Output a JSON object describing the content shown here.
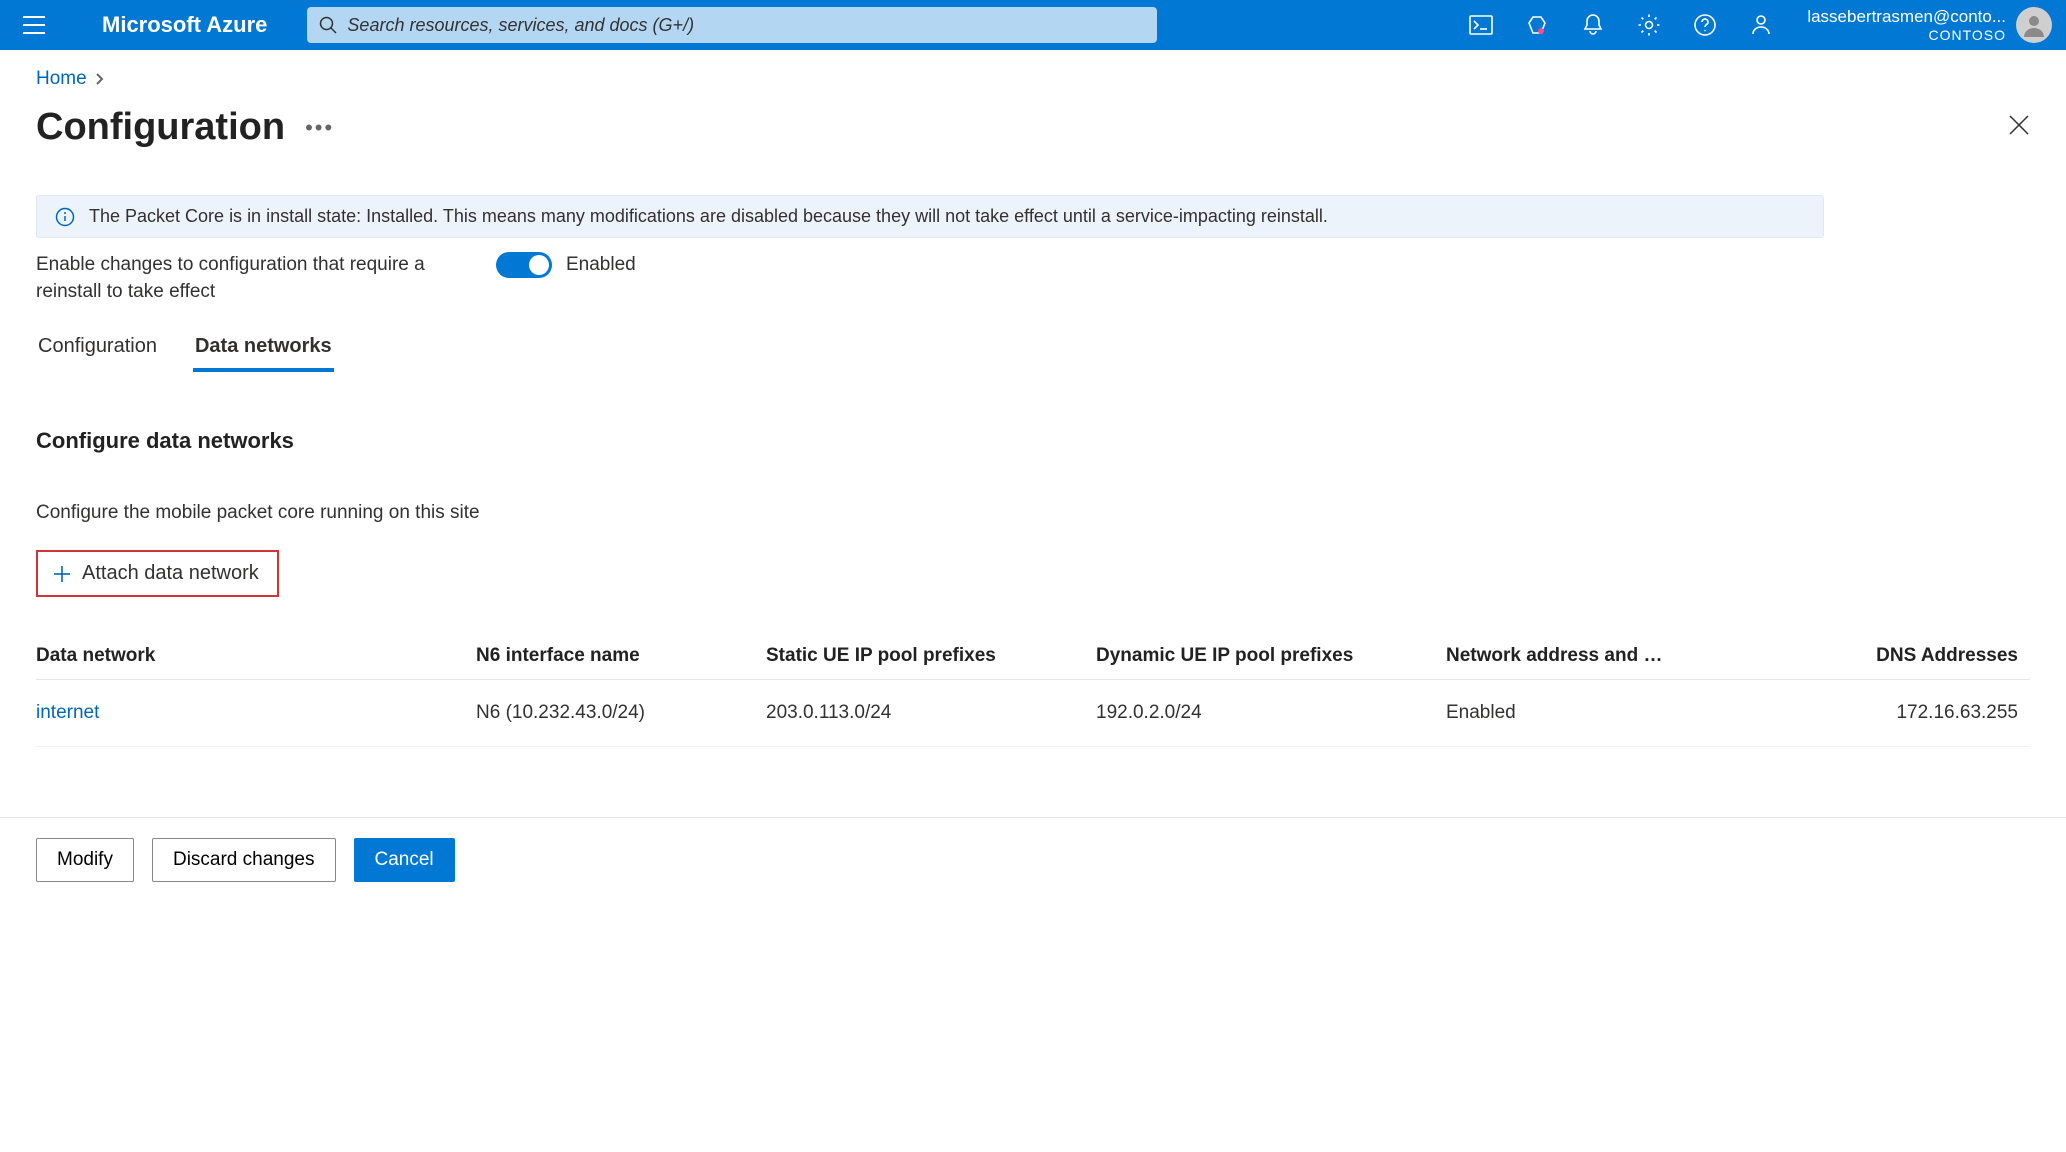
{
  "header": {
    "brand": "Microsoft Azure",
    "search_placeholder": "Search resources, services, and docs (G+/)",
    "account_email": "lassebertrasmen@conto...",
    "tenant": "CONTOSO"
  },
  "breadcrumb": {
    "home": "Home"
  },
  "page": {
    "title": "Configuration",
    "info_text": "The Packet Core is in install state: Installed. This means many modifications are disabled because they will not take effect until a service-impacting reinstall.",
    "toggle_label": "Enable changes to configuration that require a reinstall to take effect",
    "toggle_state": "Enabled"
  },
  "tabs": [
    "Configuration",
    "Data networks"
  ],
  "section": {
    "title": "Configure data networks",
    "sub": "Configure the mobile packet core running on this site",
    "attach_label": "Attach data network"
  },
  "table": {
    "headers": {
      "dn": "Data network",
      "n6": "N6 interface name",
      "sip": "Static UE IP pool prefixes",
      "dip": "Dynamic UE IP pool prefixes",
      "nat": "Network address and …",
      "dns": "DNS Addresses"
    },
    "rows": [
      {
        "dn": "internet",
        "n6": "N6 (10.232.43.0/24)",
        "sip": "203.0.113.0/24",
        "dip": "192.0.2.0/24",
        "nat": "Enabled",
        "dns": "172.16.63.255"
      }
    ]
  },
  "footer": {
    "modify": "Modify",
    "discard": "Discard changes",
    "cancel": "Cancel"
  }
}
